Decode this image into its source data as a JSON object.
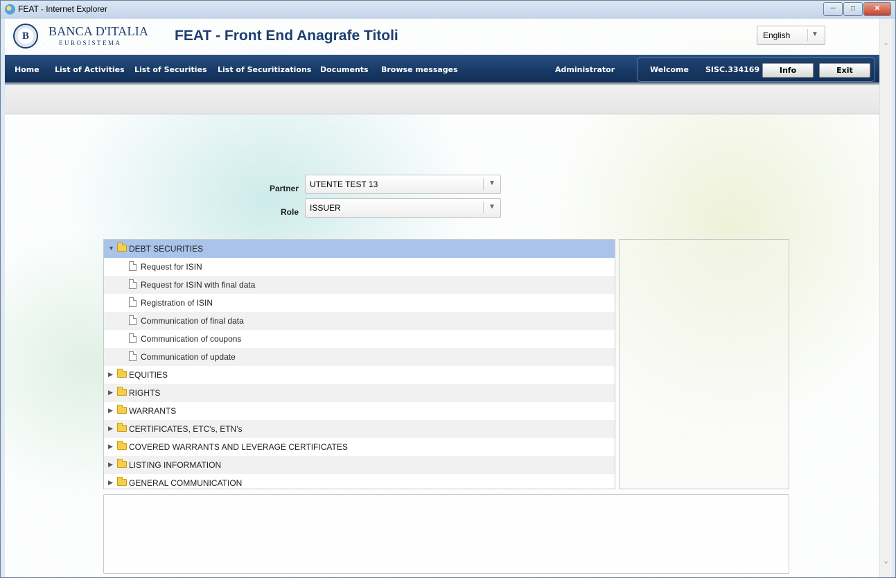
{
  "window": {
    "title": "FEAT - Internet Explorer"
  },
  "header": {
    "logo_letter": "B",
    "brand_name": "BANCA D'ITALIA",
    "brand_sub": "EUROSISTEMA",
    "app_title": "FEAT - Front End Anagrafe Titoli",
    "language": "English"
  },
  "nav": {
    "items": [
      "Home",
      "List of Activities",
      "List of Securities",
      "List of Securitizations",
      "Documents",
      "Browse messages"
    ],
    "role_label": "Administrator",
    "welcome": "Welcome",
    "user_id": "SISC.334169",
    "info_label": "Info",
    "exit_label": "Exit"
  },
  "form": {
    "partner_label": "Partner",
    "partner_value": "UTENTE TEST 13",
    "role_label": "Role",
    "role_value": "ISSUER"
  },
  "tree": {
    "root_expanded": "DEBT SECURITIES",
    "children": [
      "Request for ISIN",
      "Request for ISIN with final data",
      "Registration of ISIN",
      "Communication of final data",
      "Communication of coupons",
      "Communication of update"
    ],
    "collapsed": [
      "EQUITIES",
      "RIGHTS",
      "WARRANTS",
      "CERTIFICATES, ETC's, ETN's",
      "COVERED WARRANTS AND LEVERAGE CERTIFICATES",
      "LISTING INFORMATION",
      "GENERAL COMMUNICATION"
    ]
  }
}
